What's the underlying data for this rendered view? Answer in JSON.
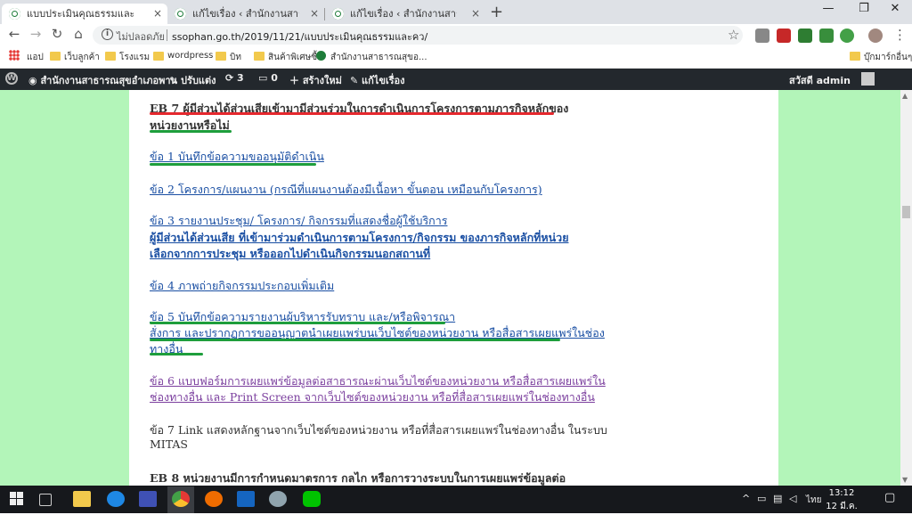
{
  "browser": {
    "tabs": [
      {
        "label": "แบบประเมินคุณธรรมและความโปร่งใส...",
        "active": true
      },
      {
        "label": "แก้ไขเรื่อง ‹ สำนักงานสาธารณสุขอำเภ",
        "active": false
      },
      {
        "label": "แก้ไขเรื่อง ‹ สำนักงานสาธารณสุขอำเภ",
        "active": false
      }
    ],
    "tab_close": "×",
    "new_tab": "+",
    "window_buttons": {
      "minimize": "—",
      "restore": "❐",
      "close": "✕"
    },
    "nav": {
      "back": "←",
      "forward": "→",
      "reload": "↻",
      "home": "⌂"
    },
    "security_label": "ไม่ปลอดภัย",
    "url": "ssophan.go.th/2019/11/21/แบบประเมินคุณธรรมและคว/",
    "star": "☆",
    "menu": "⋮",
    "bookmarks": [
      {
        "label": "แอป",
        "icon": "apps-icon"
      },
      {
        "label": "เว็บลูกค้า",
        "icon": "folder-icon"
      },
      {
        "label": "โรงแรม",
        "icon": "folder-icon"
      },
      {
        "label": "wordpress",
        "icon": "folder-icon"
      },
      {
        "label": "บิท",
        "icon": "folder-icon"
      },
      {
        "label": "สินค้าพิเศษซื้อ",
        "icon": "folder-icon"
      },
      {
        "label": "สำนักงานสาธารณสุขอ...",
        "icon": "site-icon"
      }
    ],
    "other_bookmarks": "บุ๊กมาร์กอื่นๆ"
  },
  "admin_bar": {
    "site_name": "สำนักงานสาธารณสุขอำเภอพาน",
    "customize": "ปรับแต่ง",
    "updates_count": "3",
    "comments_count": "0",
    "new": "สร้างใหม่",
    "edit_post": "แก้ไขเรื่อง",
    "greeting": "สวัสดี admin"
  },
  "content": {
    "eb7_title_1": "EB 7 ผู้มีส่วนได้ส่วนเสียเข้ามามีส่วนร่วมในการดำเนินการโครงการตามภารกิจหลักของ",
    "eb7_title_2": "หน่วยงานหรือไม่",
    "item1": "ข้อ 1 บันทึกข้อความขออนุมัติดำเนิน",
    "item2": "ข้อ 2 โครงการ/แผนงาน (กรณีที่แผนงานต้องมีเนื้อหา ขั้นตอน เหมือนกับโครงการ)",
    "item3": "ข้อ 3 รายงานประชุม/ โครงการ/ กิจกรรมที่แสดงชื่อผู้ใช้บริการ",
    "item3_b1": "ผู้มีส่วนได้ส่วนเสีย ที่เข้ามาร่วมดำเนินการตามโครงการ/กิจกรรม ของภารกิจหลักที่หน่วย",
    "item3_b2": "เลือกจากการประชุม หรือออกไปดำเนินกิจกรรมนอกสถานที่",
    "item4": "ข้อ 4 ภาพถ่ายกิจกรรมประกอบเพิ่มเติม",
    "item5_1": "ข้อ 5 บันทึกข้อความรายงานผู้บริหารรับทราบ และ/หรือพิจารณา",
    "item5_2": "สั่งการ และปรากฏการขออนุญาตนำเผยแพร่บนเว็บไซต์ของหน่วยงาน หรือสื่อสารเผยแพร่ในช่อง",
    "item5_3": "ทางอื่น",
    "item6_1": "ข้อ 6 แบบฟอร์มการเผยแพร่ข้อมูลต่อสาธารณะผ่านเว็บไซต์ของหน่วยงาน หรือสื่อสารเผยแพร่ใน",
    "item6_2": "ช่องทางอื่น และ Print Screen จากเว็บไซต์ของหน่วยงาน หรือที่สื่อสารเผยแพร่ในช่องทางอื่น",
    "item7_1": "ข้อ 7 Link แสดงหลักฐานจากเว็บไซต์ของหน่วยงาน หรือที่สื่อสารเผยแพร่ในช่องทางอื่น ในระบบ",
    "item7_2": "MITAS",
    "eb8_title": "EB 8 หน่วยงานมีการกำหนดมาตรการ กลไก หรือการวางระบบในการเผยแพร่ข้อมูลต่อ"
  },
  "taskbar": {
    "time": "13:12",
    "date": "12 มี.ค. 2563",
    "lang": "ไทย"
  },
  "colors": {
    "page_bg": "#b3f5b9",
    "link": "#1a4fa3",
    "visited": "#7b3f9e",
    "red_mark": "#e5282e",
    "green_mark": "#1e9e3c",
    "admin_bar": "#23282d"
  }
}
